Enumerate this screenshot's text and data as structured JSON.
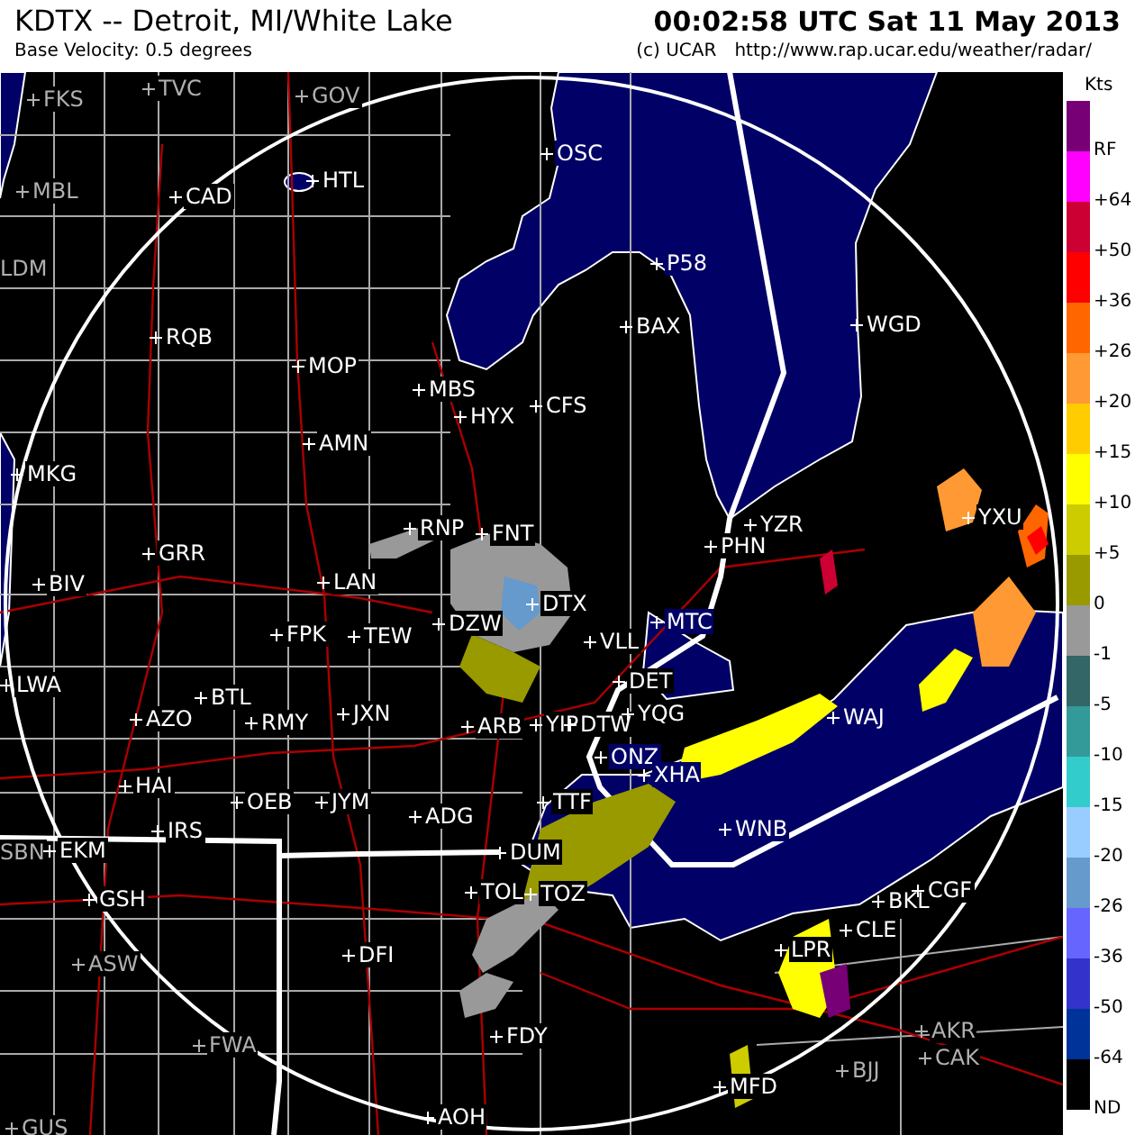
{
  "header": {
    "title": "KDTX -- Detroit, MI/White Lake",
    "time": "00:02:58 UTC Sat 11 May 2013",
    "subtitle": "Base Velocity: 0.5 degrees",
    "credit": "(c) UCAR",
    "url": "http://www.rap.ucar.edu/weather/radar/"
  },
  "legend": {
    "unit": "Kts",
    "items": [
      {
        "label": "RF",
        "color": "#770077"
      },
      {
        "label": "+64",
        "color": "#ff00ff"
      },
      {
        "label": "+50",
        "color": "#cc0033"
      },
      {
        "label": "+36",
        "color": "#ff0000"
      },
      {
        "label": "+26",
        "color": "#ff6600"
      },
      {
        "label": "+20",
        "color": "#ff9933"
      },
      {
        "label": "+15",
        "color": "#ffcc00"
      },
      {
        "label": "+10",
        "color": "#ffff00"
      },
      {
        "label": "+5",
        "color": "#cccc00"
      },
      {
        "label": "0",
        "color": "#999900"
      },
      {
        "label": "-1",
        "color": "#999999"
      },
      {
        "label": "-5",
        "color": "#336666"
      },
      {
        "label": "-10",
        "color": "#339999"
      },
      {
        "label": "-15",
        "color": "#33cccc"
      },
      {
        "label": "-20",
        "color": "#99ccff"
      },
      {
        "label": "-26",
        "color": "#6699cc"
      },
      {
        "label": "-36",
        "color": "#6666ff"
      },
      {
        "label": "-50",
        "color": "#3333cc"
      },
      {
        "label": "-64",
        "color": "#003399"
      },
      {
        "label": "ND",
        "color": "#000000"
      }
    ]
  },
  "map": {
    "stations": [
      {
        "code": "FKS",
        "dimmed": true
      },
      {
        "code": "TVC",
        "dimmed": true
      },
      {
        "code": "GOV",
        "dimmed": true
      },
      {
        "code": "OSC",
        "dimmed": false
      },
      {
        "code": "MBL",
        "dimmed": true
      },
      {
        "code": "CAD",
        "dimmed": false
      },
      {
        "code": "HTL",
        "dimmed": false
      },
      {
        "code": "LDM",
        "dimmed": true
      },
      {
        "code": "P58",
        "dimmed": false
      },
      {
        "code": "RQB",
        "dimmed": false
      },
      {
        "code": "BAX",
        "dimmed": false
      },
      {
        "code": "WGD",
        "dimmed": false
      },
      {
        "code": "MOP",
        "dimmed": false
      },
      {
        "code": "MBS",
        "dimmed": false
      },
      {
        "code": "HYX",
        "dimmed": false
      },
      {
        "code": "CFS",
        "dimmed": false
      },
      {
        "code": "AMN",
        "dimmed": false
      },
      {
        "code": "MKG",
        "dimmed": false
      },
      {
        "code": "RNP",
        "dimmed": false
      },
      {
        "code": "FNT",
        "dimmed": false
      },
      {
        "code": "YZR",
        "dimmed": false
      },
      {
        "code": "YXU",
        "dimmed": false
      },
      {
        "code": "GRR",
        "dimmed": false
      },
      {
        "code": "PHN",
        "dimmed": false
      },
      {
        "code": "BIV",
        "dimmed": false
      },
      {
        "code": "LAN",
        "dimmed": false
      },
      {
        "code": "DTX",
        "dimmed": false
      },
      {
        "code": "FPK",
        "dimmed": false
      },
      {
        "code": "TEW",
        "dimmed": false
      },
      {
        "code": "DZW",
        "dimmed": false
      },
      {
        "code": "VLL",
        "dimmed": false
      },
      {
        "code": "MTC",
        "dimmed": false
      },
      {
        "code": "LWA",
        "dimmed": false
      },
      {
        "code": "BTL",
        "dimmed": false
      },
      {
        "code": "DET",
        "dimmed": false
      },
      {
        "code": "AZO",
        "dimmed": false
      },
      {
        "code": "RMY",
        "dimmed": false
      },
      {
        "code": "JXN",
        "dimmed": false
      },
      {
        "code": "ARB",
        "dimmed": false
      },
      {
        "code": "YIP",
        "dimmed": false
      },
      {
        "code": "DTW",
        "dimmed": false
      },
      {
        "code": "YQG",
        "dimmed": false
      },
      {
        "code": "WAJ",
        "dimmed": false
      },
      {
        "code": "ONZ",
        "dimmed": false
      },
      {
        "code": "XHA",
        "dimmed": false
      },
      {
        "code": "HAI",
        "dimmed": false
      },
      {
        "code": "OEB",
        "dimmed": false
      },
      {
        "code": "JYM",
        "dimmed": false
      },
      {
        "code": "TTF",
        "dimmed": false
      },
      {
        "code": "ADG",
        "dimmed": false
      },
      {
        "code": "IRS",
        "dimmed": false
      },
      {
        "code": "WNB",
        "dimmed": false
      },
      {
        "code": "SBN",
        "dimmed": true
      },
      {
        "code": "EKM",
        "dimmed": false
      },
      {
        "code": "DUM",
        "dimmed": false
      },
      {
        "code": "GSH",
        "dimmed": false
      },
      {
        "code": "TOL",
        "dimmed": false
      },
      {
        "code": "TOZ",
        "dimmed": false
      },
      {
        "code": "BKL",
        "dimmed": false
      },
      {
        "code": "CGF",
        "dimmed": false
      },
      {
        "code": "CLE",
        "dimmed": false
      },
      {
        "code": "DFI",
        "dimmed": false
      },
      {
        "code": "LPR",
        "dimmed": false
      },
      {
        "code": "ASW",
        "dimmed": true
      },
      {
        "code": "FDY",
        "dimmed": false
      },
      {
        "code": "AKR",
        "dimmed": true
      },
      {
        "code": "FWA",
        "dimmed": true
      },
      {
        "code": "CAK",
        "dimmed": true
      },
      {
        "code": "BJJ",
        "dimmed": true
      },
      {
        "code": "MFD",
        "dimmed": false
      },
      {
        "code": "AOH",
        "dimmed": false
      },
      {
        "code": "GUS",
        "dimmed": true
      }
    ]
  }
}
